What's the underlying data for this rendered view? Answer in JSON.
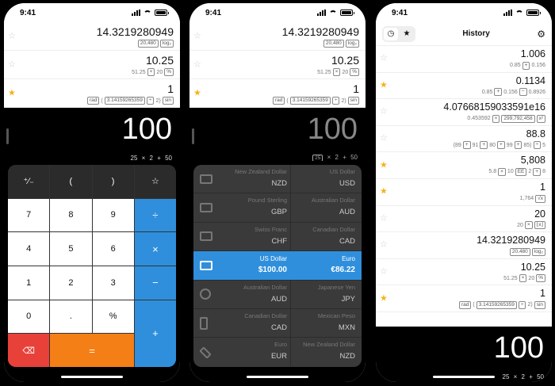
{
  "status_time": "9:41",
  "history_top": [
    {
      "starred": false,
      "result": "14.3219280949",
      "expr": [
        "20,480",
        "log₂"
      ]
    },
    {
      "starred": false,
      "result": "10.25",
      "expr": [
        "51.25",
        "×",
        "20",
        "%"
      ]
    },
    {
      "starred": true,
      "result": "1",
      "expr": [
        "rad",
        "(",
        "3.14159265359",
        "÷",
        "2)",
        "sin"
      ]
    }
  ],
  "display": {
    "value": "100",
    "expression": "25 × 2 + 50"
  },
  "display_dim": {
    "value": "100",
    "expr_parts": [
      "25",
      "× 2 + 50"
    ]
  },
  "keypad": {
    "row1": [
      "⁺⁄₋",
      "(",
      ")",
      "☆"
    ],
    "row2": [
      "7",
      "8",
      "9",
      "÷"
    ],
    "row3": [
      "4",
      "5",
      "6",
      "×"
    ],
    "row4": [
      "1",
      "2",
      "3",
      "−"
    ],
    "row5": [
      "0",
      ".",
      "%",
      "+"
    ],
    "back": "⌫",
    "equals": "="
  },
  "currencies": [
    {
      "left_name": "New Zealand Dollar",
      "left_code": "NZD",
      "right_name": "US Dollar",
      "right_code": "USD"
    },
    {
      "left_name": "Pound Sterling",
      "left_code": "GBP",
      "right_name": "Australian Dollar",
      "right_code": "AUD"
    },
    {
      "left_name": "Swiss Franc",
      "left_code": "CHF",
      "right_name": "Canadian Dollar",
      "right_code": "CAD"
    },
    {
      "left_name": "US Dollar",
      "left_code": "$100.00",
      "right_name": "Euro",
      "right_code": "€86.22",
      "selected": true
    },
    {
      "left_name": "Australian Dollar",
      "left_code": "AUD",
      "right_name": "Japanese Yen",
      "right_code": "JPY"
    },
    {
      "left_name": "Canadian Dollar",
      "left_code": "CAD",
      "right_name": "Mexican Peso",
      "right_code": "MXN"
    },
    {
      "left_name": "Euro",
      "left_code": "EUR",
      "right_name": "New Zealand Dollar",
      "right_code": "NZD"
    }
  ],
  "history_screen": {
    "title": "History",
    "items": [
      {
        "starred": false,
        "result": "1.006",
        "expr": [
          "0.85",
          "+",
          "0.156"
        ]
      },
      {
        "starred": true,
        "result": "0.1134",
        "expr": [
          "0.85",
          "+",
          "0.156",
          "−",
          "0.8926"
        ]
      },
      {
        "starred": false,
        "result": "4.07668159033591e16",
        "expr": [
          "0.453592",
          "×",
          "299,792,458",
          "x²"
        ]
      },
      {
        "starred": false,
        "result": "88.8",
        "expr": [
          "(89",
          "+",
          "91",
          "+",
          "80",
          "+",
          "99",
          "+",
          "85)",
          "÷",
          "5"
        ]
      },
      {
        "starred": true,
        "result": "5,808",
        "expr": [
          "5.8",
          "×",
          "10",
          "EE",
          "2",
          "+",
          "8"
        ]
      },
      {
        "starred": true,
        "result": "1",
        "expr": [
          "1,764",
          "√x"
        ]
      },
      {
        "starred": false,
        "result": "20",
        "expr": [
          "20",
          "×",
          "⌊x⌋"
        ]
      },
      {
        "starred": false,
        "result": "14.3219280949",
        "expr": [
          "20,480",
          "log₂"
        ]
      },
      {
        "starred": false,
        "result": "10.25",
        "expr": [
          "51.25",
          "×",
          "20",
          "%"
        ]
      },
      {
        "starred": true,
        "result": "1",
        "expr": [
          "rad",
          "(",
          "3.14159265359",
          "÷",
          "2)",
          "sin"
        ]
      }
    ]
  }
}
